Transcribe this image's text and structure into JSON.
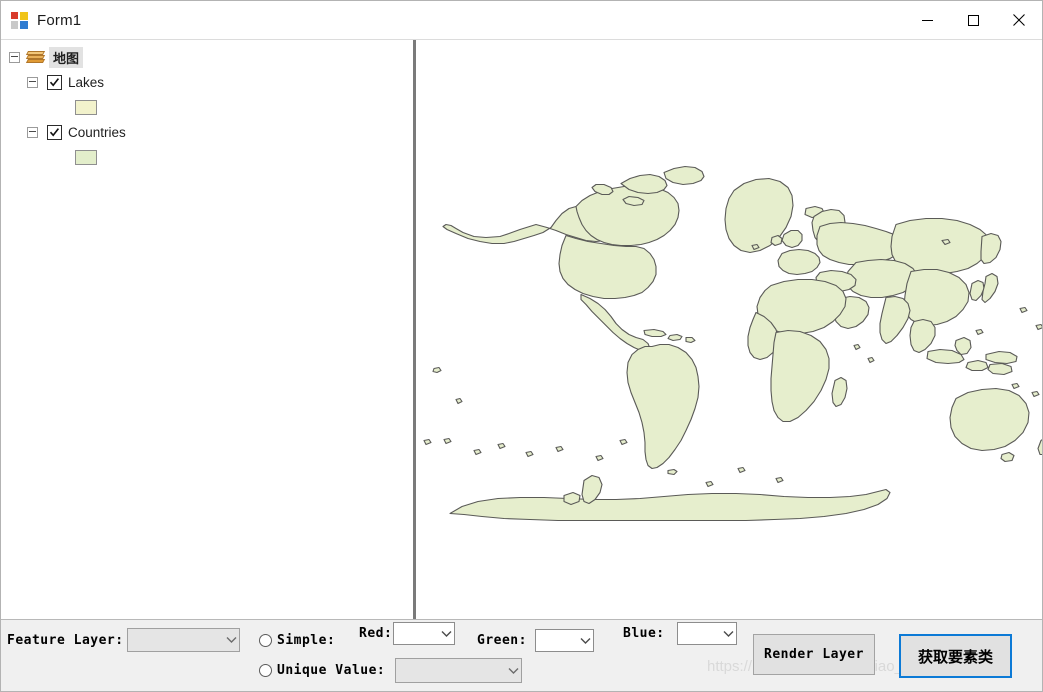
{
  "window": {
    "title": "Form1",
    "icon": "winforms-icon",
    "controls": {
      "minimize": "minimize-icon",
      "maximize": "maximize-icon",
      "close": "close-icon"
    }
  },
  "tree": {
    "root": {
      "label": "地图",
      "icon": "layers-icon",
      "selected": true,
      "expanded": true
    },
    "layers": [
      {
        "label": "Lakes",
        "checked": true,
        "expanded": true,
        "swatch_color": "#f2f2cc",
        "swatch_border": "#8f8f8f"
      },
      {
        "label": "Countries",
        "checked": true,
        "expanded": true,
        "swatch_color": "#e3eecb",
        "swatch_border": "#8f8f8f"
      }
    ]
  },
  "map": {
    "land_fill": "#e6eecd",
    "land_stroke": "#5a5a57",
    "background": "#ffffff"
  },
  "toolbar": {
    "feature_layer_label": "Feature Layer:",
    "feature_layer_value": "",
    "feature_layer_enabled": false,
    "simple_label": "Simple:",
    "simple_checked": false,
    "unique_value_label": "Unique Value:",
    "unique_value_checked": false,
    "unique_value_combo_value": "",
    "red_label": "Red:",
    "red_value": "",
    "green_label": "Green:",
    "green_value": "",
    "blue_label": "Blue:",
    "blue_value": "",
    "render_layer_button": "Render Layer",
    "get_feature_class_button": "获取要素类",
    "focus_color": "#0c7ad6"
  },
  "watermark": {
    "text": "https://blog.csdn.net/IT_xiao_guang_guang"
  }
}
